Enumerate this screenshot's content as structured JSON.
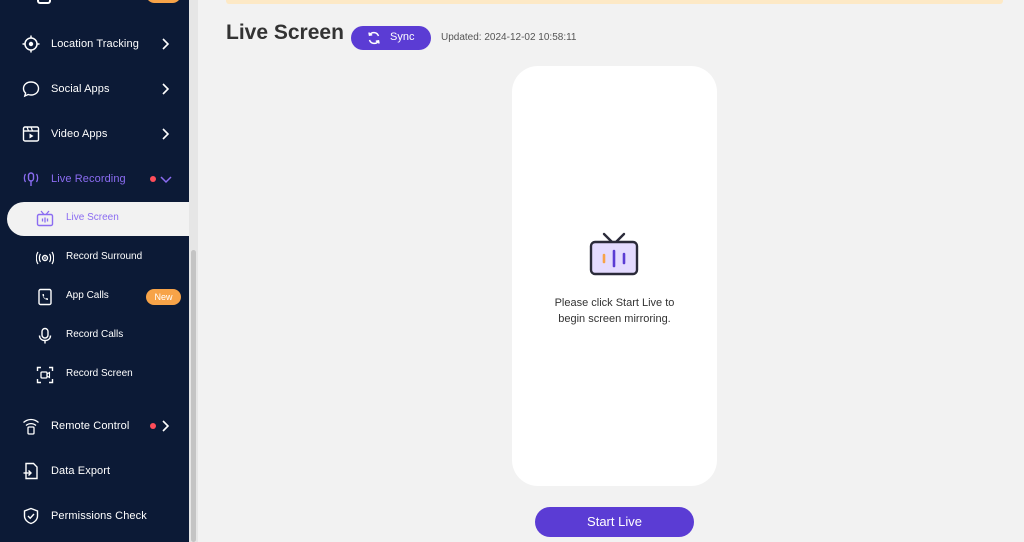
{
  "sidebar": {
    "items": [
      {
        "label": "Location Tracking",
        "icon": "location-target-icon"
      },
      {
        "label": "Social Apps",
        "icon": "chat-bubble-icon"
      },
      {
        "label": "Video Apps",
        "icon": "video-clapper-icon"
      },
      {
        "label": "Live Recording",
        "icon": "microphone-broadcast-icon"
      },
      {
        "label": "Remote Control",
        "icon": "remote-signal-icon"
      },
      {
        "label": "Data Export",
        "icon": "export-file-icon"
      },
      {
        "label": "Permissions Check",
        "icon": "shield-check-icon"
      }
    ],
    "sub_items": [
      {
        "label": "Live Screen",
        "icon": "tv-icon"
      },
      {
        "label": "Record Surround",
        "icon": "surround-sound-icon"
      },
      {
        "label": "App Calls",
        "icon": "phone-icon",
        "badge": "New"
      },
      {
        "label": "Record Calls",
        "icon": "microphone-icon"
      },
      {
        "label": "Record Screen",
        "icon": "screen-record-icon"
      }
    ]
  },
  "main": {
    "title": "Live Screen",
    "sync_label": "Sync",
    "updated": "Updated: 2024-12-02 10:58:11",
    "placeholder_line1": "Please click Start Live to",
    "placeholder_line2": "begin screen mirroring.",
    "start_label": "Start Live"
  },
  "colors": {
    "sidebar_bg": "#0c1a36",
    "accent": "#5b3cd4",
    "active_text": "#8b6cf2",
    "badge": "#f7a348",
    "dot": "#ff4d5a"
  }
}
